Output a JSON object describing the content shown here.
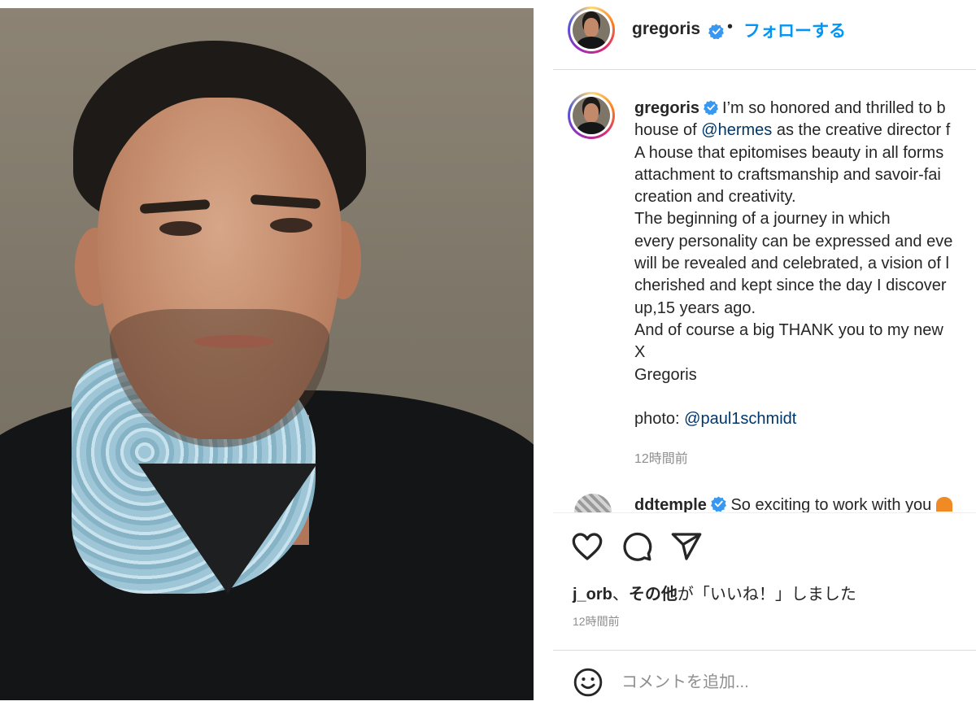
{
  "post": {
    "image_alt": "Portrait of gregoris"
  },
  "header": {
    "username": "gregoris",
    "separator": "•",
    "follow_label": "フォローする"
  },
  "caption": {
    "username": "gregoris",
    "segments": [
      {
        "text": "I’m so honored and thrilled to b",
        "type": "text"
      },
      {
        "text": "\nhouse of ",
        "type": "text"
      },
      {
        "text": "@hermes",
        "type": "mention"
      },
      {
        "text": " as the creative director f\nA house that epitomises beauty in all forms\nattachment to craftsmanship and savoir-fai\ncreation and creativity.\nThe beginning of a journey in which\nevery personality can be expressed and eve\nwill be revealed and celebrated, a vision of l\ncherished and kept since the day I discover\nup,15 years ago.\nAnd of course a big THANK you to my new\nX\nGregoris\n\nphoto: ",
        "type": "text"
      },
      {
        "text": "@paul1schmidt",
        "type": "mention"
      }
    ],
    "timestamp": "12時間前"
  },
  "comment2": {
    "username": "ddtemple",
    "text": "So exciting to work with you "
  },
  "actions": {
    "like_icon": "heart-icon",
    "comment_icon": "comment-icon",
    "share_icon": "send-icon"
  },
  "likes": {
    "user": "j_orb",
    "sep": "、",
    "others": "その他",
    "suffix": "が「いいね！」しました"
  },
  "timestamp": "12時間前",
  "add_comment": {
    "placeholder": "コメントを追加..."
  },
  "colors": {
    "accent": "#0095f6",
    "mention": "#00376b",
    "muted": "#8e8e8e",
    "verified": "#3897f0"
  }
}
